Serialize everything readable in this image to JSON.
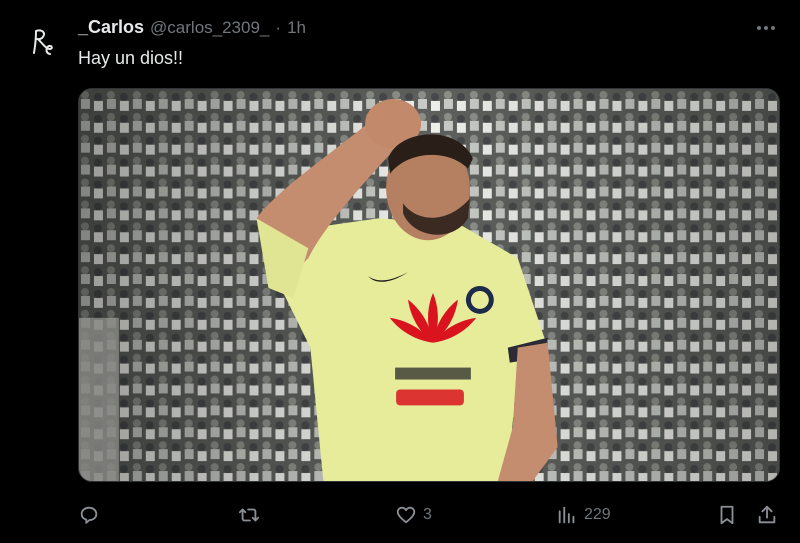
{
  "tweet": {
    "display_name": "_Carlos",
    "handle": "@carlos_2309_",
    "separator": "·",
    "time": "1h",
    "text": "Hay un dios!!",
    "media_alt": "Footballer in yellow América jersey with HUAWEI and Coca-Cola sponsors raising a fist in a stadium"
  },
  "actions": {
    "reply_count": "",
    "repost_count": "",
    "like_count": "3",
    "views_count": "229"
  },
  "colors": {
    "background": "#000000",
    "text_primary": "#e7e9ea",
    "text_secondary": "#71767b",
    "jersey": "#e8ee9a",
    "huawei_red": "#d9141f"
  },
  "icons": [
    "avatar-signature-icon",
    "more-icon",
    "reply-icon",
    "repost-icon",
    "like-icon",
    "views-icon",
    "bookmark-icon",
    "share-icon"
  ]
}
